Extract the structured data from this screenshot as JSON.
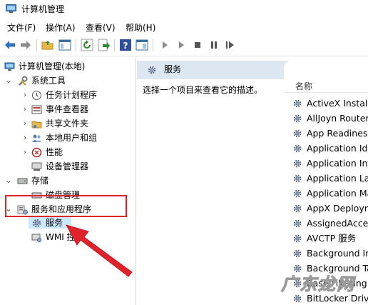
{
  "window": {
    "title": "计算机管理"
  },
  "menu": [
    "文件(F)",
    "操作(A)",
    "查看(V)",
    "帮助(H)"
  ],
  "tree": {
    "root": "计算机管理(本地)",
    "system_tools": {
      "label": "系统工具",
      "children": [
        "任务计划程序",
        "事件查看器",
        "共享文件夹",
        "本地用户和组",
        "性能",
        "设备管理器"
      ]
    },
    "storage": {
      "label": "存储",
      "children": [
        "磁盘管理"
      ]
    },
    "services_apps": {
      "label": "服务和应用程序",
      "children": [
        "服务",
        "WMI 控件"
      ]
    }
  },
  "main": {
    "header": "服务",
    "description": "选择一个项目来查看它的描述。",
    "column_name": "名称",
    "services": [
      "ActiveX Installer",
      "AllJoyn Router",
      "App Readiness",
      "Application Identity",
      "Application Information",
      "Application Layer",
      "Application Management",
      "AppX Deployment",
      "AssignedAccess",
      "AVCTP 服务",
      "Background Intelligent",
      "Background Tasks",
      "Base Filtering Engine",
      "BitLocker Drive"
    ]
  },
  "watermark": "广东龙网",
  "colors": {
    "selection": "#cce8ff",
    "highlight_box": "#e0232a",
    "arrow": "#e0232a",
    "header_bg": "#dde7f1"
  }
}
